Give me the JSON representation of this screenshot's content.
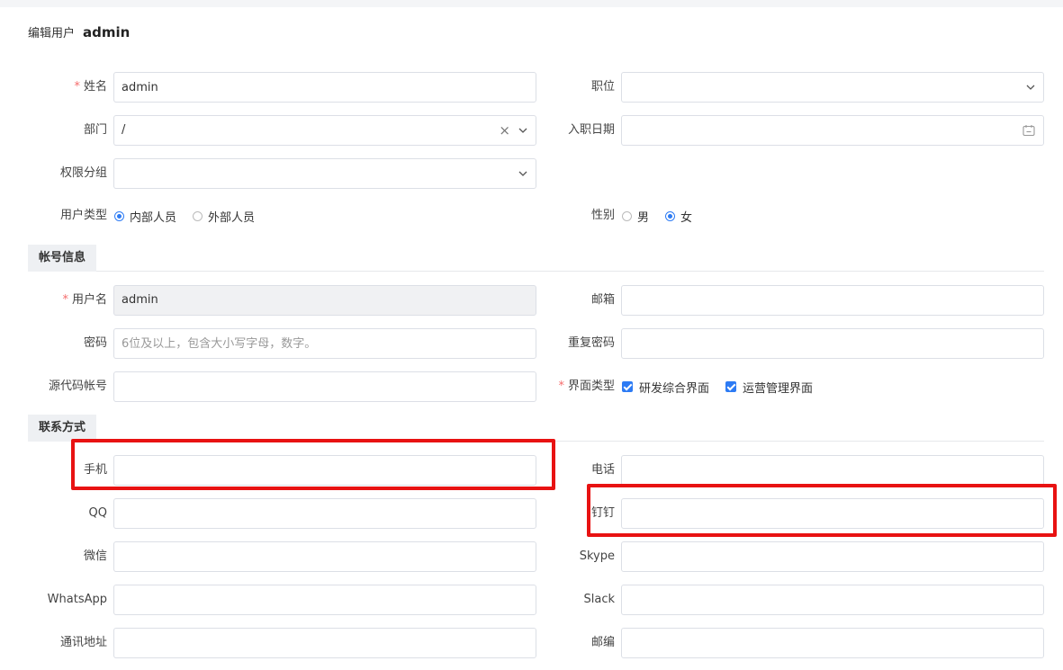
{
  "header": {
    "title": "编辑用户",
    "username": "admin"
  },
  "basic": {
    "name": {
      "label": "姓名",
      "value": "admin"
    },
    "position": {
      "label": "职位",
      "value": ""
    },
    "department": {
      "label": "部门",
      "value": "/"
    },
    "join_date": {
      "label": "入职日期",
      "value": ""
    },
    "permission_group": {
      "label": "权限分组",
      "value": ""
    },
    "user_type": {
      "label": "用户类型",
      "options": [
        "内部人员",
        "外部人员"
      ],
      "selected": "内部人员"
    },
    "gender": {
      "label": "性别",
      "options": [
        "男",
        "女"
      ],
      "selected": "女"
    }
  },
  "account_section": {
    "title": "帐号信息",
    "username": {
      "label": "用户名",
      "value": "admin"
    },
    "email": {
      "label": "邮箱",
      "value": ""
    },
    "password": {
      "label": "密码",
      "placeholder": "6位及以上，包含大小写字母，数字。"
    },
    "repeat_password": {
      "label": "重复密码",
      "value": ""
    },
    "source_account": {
      "label": "源代码帐号",
      "value": ""
    },
    "ui_type": {
      "label": "界面类型",
      "options": [
        "研发综合界面",
        "运营管理界面"
      ],
      "checked": [
        "研发综合界面",
        "运营管理界面"
      ]
    }
  },
  "contact_section": {
    "title": "联系方式",
    "mobile": {
      "label": "手机",
      "value": ""
    },
    "phone": {
      "label": "电话",
      "value": ""
    },
    "qq": {
      "label": "QQ",
      "value": ""
    },
    "dingtalk": {
      "label": "钉钉",
      "value": ""
    },
    "wechat": {
      "label": "微信",
      "value": ""
    },
    "skype": {
      "label": "Skype",
      "value": ""
    },
    "whatsapp": {
      "label": "WhatsApp",
      "value": ""
    },
    "slack": {
      "label": "Slack",
      "value": ""
    },
    "address": {
      "label": "通讯地址",
      "value": ""
    },
    "zipcode": {
      "label": "邮编",
      "value": ""
    }
  },
  "colors": {
    "accent": "#2d7bf4",
    "required": "#f56c6c",
    "highlight": "#e81212",
    "border": "#dcdfe6"
  }
}
